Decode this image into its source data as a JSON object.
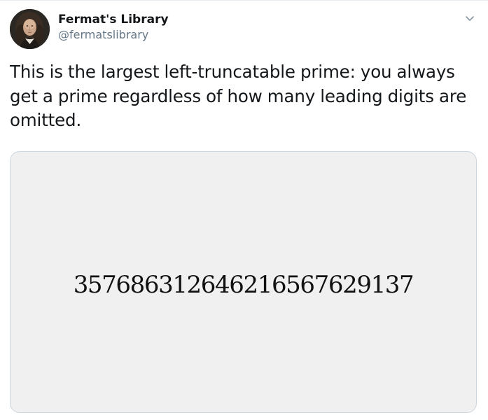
{
  "tweet": {
    "author": {
      "display_name": "Fermat's Library",
      "handle": "@fermatslibrary",
      "avatar_icon": "portrait-avatar"
    },
    "menu_icon": "chevron-down-icon",
    "text": "This is the largest left-truncatable prime: you always get a prime regardless of how many leading digits are omitted.",
    "media": {
      "number": "357686312646216567629137",
      "background": "#f0f0f0"
    }
  },
  "colors": {
    "primary_text": "#14171a",
    "secondary_text": "#657786",
    "border": "#ccd6dd",
    "caret": "#8899a6"
  }
}
